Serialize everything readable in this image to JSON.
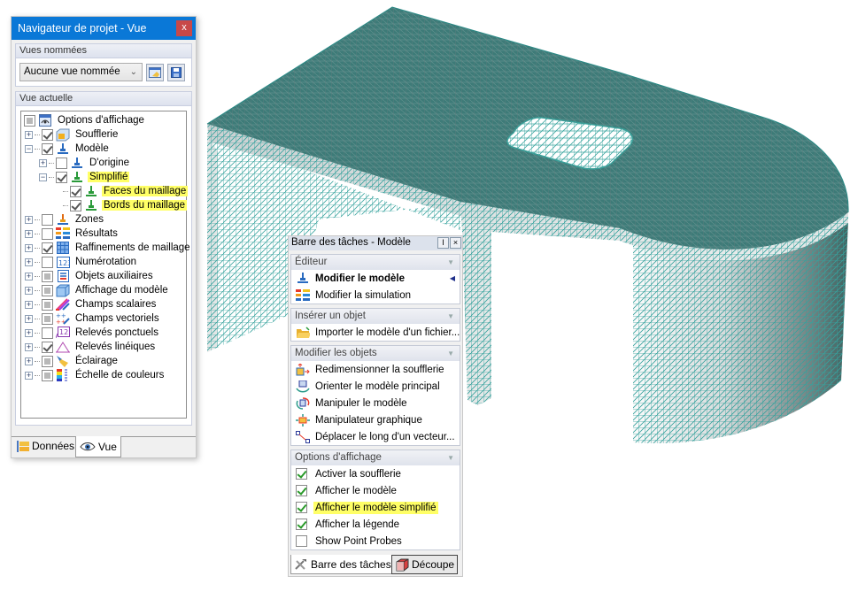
{
  "navigator": {
    "title": "Navigateur de projet - Vue",
    "close_label": "x",
    "named_views": {
      "header": "Vues nommées",
      "selected": "Aucune vue nommée",
      "buttons": [
        {
          "icon": "apply-view-icon"
        },
        {
          "icon": "save-view-icon"
        }
      ]
    },
    "current_view": {
      "header": "Vue actuelle",
      "tree": [
        {
          "label": "Options d'affichage",
          "level": 0,
          "expander": "",
          "check": "partial",
          "icon": "display-options-icon",
          "highlight": false
        },
        {
          "label": "Soufflerie",
          "level": 1,
          "expander": "+",
          "check": "checked",
          "icon": "wind-tunnel-icon",
          "highlight": false
        },
        {
          "label": "Modèle",
          "level": 1,
          "expander": "-",
          "check": "checked",
          "icon": "model-icon",
          "highlight": false
        },
        {
          "label": "D'origine",
          "level": 2,
          "expander": "+",
          "check": "unchecked",
          "icon": "model-icon",
          "highlight": false
        },
        {
          "label": "Simplifié",
          "level": 2,
          "expander": "-",
          "check": "checked",
          "icon": "simplified-model-icon",
          "highlight": true
        },
        {
          "label": "Faces du maillage",
          "level": 3,
          "expander": "",
          "check": "checked",
          "icon": "simplified-model-icon",
          "highlight": true
        },
        {
          "label": "Bords du maillage",
          "level": 3,
          "expander": "",
          "check": "checked",
          "icon": "simplified-model-icon",
          "highlight": true
        },
        {
          "label": "Zones",
          "level": 1,
          "expander": "+",
          "check": "unchecked",
          "icon": "zones-icon",
          "highlight": false
        },
        {
          "label": "Résultats",
          "level": 1,
          "expander": "+",
          "check": "unchecked",
          "icon": "results-icon",
          "highlight": false
        },
        {
          "label": "Raffinements de maillage",
          "level": 1,
          "expander": "+",
          "check": "checked",
          "icon": "mesh-refinement-icon",
          "highlight": false
        },
        {
          "label": "Numérotation",
          "level": 1,
          "expander": "+",
          "check": "unchecked",
          "icon": "numbering-icon",
          "highlight": false
        },
        {
          "label": "Objets auxiliaires",
          "level": 1,
          "expander": "+",
          "check": "partial",
          "icon": "auxiliary-objects-icon",
          "highlight": false
        },
        {
          "label": "Affichage du modèle",
          "level": 1,
          "expander": "+",
          "check": "partial",
          "icon": "model-display-icon",
          "highlight": false
        },
        {
          "label": "Champs scalaires",
          "level": 1,
          "expander": "+",
          "check": "partial",
          "icon": "scalar-fields-icon",
          "highlight": false
        },
        {
          "label": "Champs vectoriels",
          "level": 1,
          "expander": "+",
          "check": "partial",
          "icon": "vector-fields-icon",
          "highlight": false
        },
        {
          "label": "Relevés ponctuels",
          "level": 1,
          "expander": "+",
          "check": "unchecked",
          "icon": "point-probes-icon",
          "highlight": false
        },
        {
          "label": "Relevés linéiques",
          "level": 1,
          "expander": "+",
          "check": "checked",
          "icon": "line-probes-icon",
          "highlight": false
        },
        {
          "label": "Éclairage",
          "level": 1,
          "expander": "+",
          "check": "partial",
          "icon": "lighting-icon",
          "highlight": false
        },
        {
          "label": "Échelle de couleurs",
          "level": 1,
          "expander": "+",
          "check": "partial",
          "icon": "color-scale-icon",
          "highlight": false
        }
      ]
    },
    "tabs": [
      {
        "label": "Données",
        "icon": "data-tree-icon",
        "active": false
      },
      {
        "label": "Vue",
        "icon": "eye-icon",
        "active": true
      }
    ]
  },
  "taskbar": {
    "title": "Barre des tâches - Modèle",
    "pin_label": "I",
    "close_label": "×",
    "sections": [
      {
        "header": "Éditeur",
        "items": [
          {
            "label": "Modifier le modèle",
            "icon": "model-icon",
            "bold": true,
            "active": true
          },
          {
            "label": "Modifier la simulation",
            "icon": "results-icon",
            "bold": false,
            "active": false
          }
        ]
      },
      {
        "header": "Insérer un objet",
        "items": [
          {
            "label": "Importer le modèle d'un fichier...",
            "icon": "open-folder-icon",
            "bold": false,
            "active": false
          }
        ]
      },
      {
        "header": "Modifier les objets",
        "items": [
          {
            "label": "Redimensionner la soufflerie",
            "icon": "resize-wind-tunnel-icon",
            "bold": false,
            "active": false
          },
          {
            "label": "Orienter le modèle principal",
            "icon": "orient-model-icon",
            "bold": false,
            "active": false
          },
          {
            "label": "Manipuler le modèle",
            "icon": "manipulate-model-icon",
            "bold": false,
            "active": false
          },
          {
            "label": "Manipulateur graphique",
            "icon": "graphic-manipulator-icon",
            "bold": false,
            "active": false
          },
          {
            "label": "Déplacer le long d'un vecteur...",
            "icon": "move-along-vector-icon",
            "bold": false,
            "active": false
          }
        ]
      }
    ],
    "display_options": {
      "header": "Options d'affichage",
      "options": [
        {
          "label": "Activer la soufflerie",
          "checked": true,
          "highlight": false
        },
        {
          "label": "Afficher le modèle",
          "checked": true,
          "highlight": false
        },
        {
          "label": "Afficher le modèle simplifié",
          "checked": true,
          "highlight": true
        },
        {
          "label": "Afficher la légende",
          "checked": true,
          "highlight": false
        },
        {
          "label": "Show Point Probes",
          "checked": false,
          "highlight": false
        }
      ]
    },
    "tabs": [
      {
        "label": "Barre des tâches",
        "icon": "tools-icon",
        "active": true
      },
      {
        "label": "Découpe",
        "icon": "clipping-box-icon",
        "active": false
      }
    ]
  },
  "viewport": {
    "model_name": "simplified-mesh-model",
    "colors": {
      "top_face": "#3d7b78",
      "mesh_line": "#2a9a96",
      "side_face_light": "#e6e9ea",
      "side_face_dark": "#4d6e6c"
    }
  }
}
